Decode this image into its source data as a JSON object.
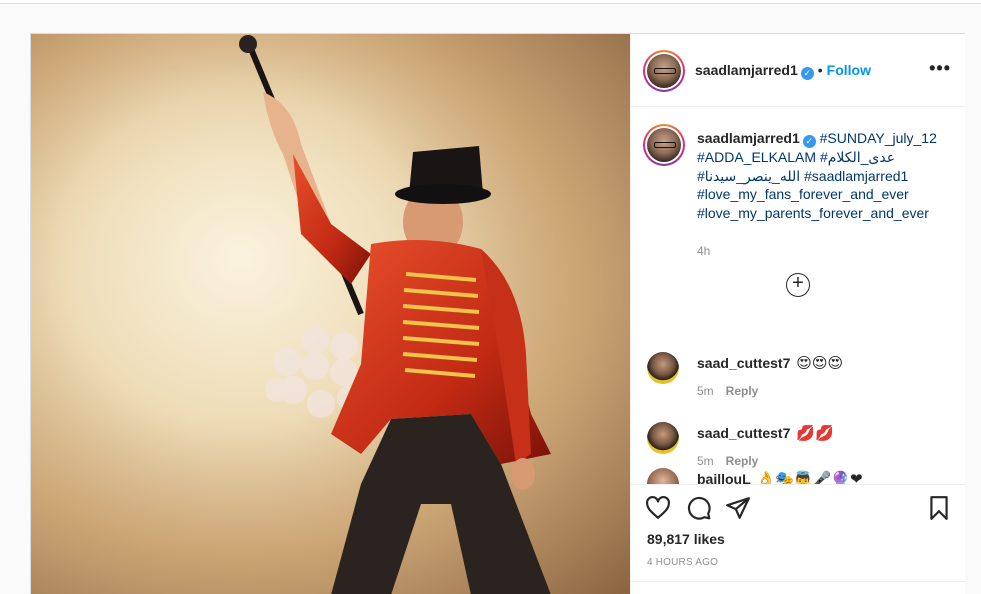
{
  "post": {
    "username": "saadlamjarred1",
    "follow_label": "Follow",
    "more_label": "•••",
    "verified": true,
    "caption": {
      "username": "saadlamjarred1",
      "lines": [
        "#SUNDAY_july_12",
        "#ADDA_ELKALAM #عدى_الكلام",
        "#الله_ينصر_سيدنا #saadlamjarred1",
        "#love_my_fans_forever_and_ever",
        "#love_my_parents_forever_and_ever"
      ],
      "time": "4h"
    },
    "comments": [
      {
        "username": "saad_cuttest7",
        "text": "😍😍😍",
        "time": "5m",
        "reply_label": "Reply"
      },
      {
        "username": "saad_cuttest7",
        "text": "💋💋",
        "time": "5m",
        "reply_label": "Reply"
      },
      {
        "username": "baillouL",
        "text": "👌🎭👼🎤🔮❤"
      }
    ],
    "likes": "89,817 likes",
    "posted": "4 HOURS AGO"
  },
  "icons": {
    "like": "heart-icon",
    "comment": "comment-icon",
    "share": "share-icon",
    "save": "bookmark-icon",
    "more": "more-icon",
    "add": "plus-circle-icon"
  },
  "colors": {
    "link": "#00376b",
    "follow": "#0095f6",
    "verified": "#3897f0",
    "muted": "#8e8e8e"
  }
}
